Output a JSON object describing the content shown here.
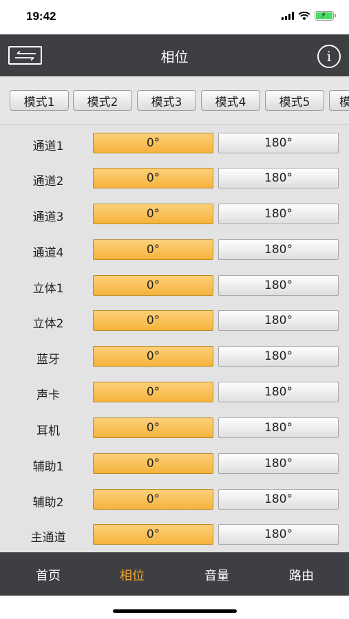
{
  "status_bar": {
    "time": "19:42"
  },
  "nav": {
    "title": "相位",
    "info_symbol": "i"
  },
  "modes": [
    "模式1",
    "模式2",
    "模式3",
    "模式4",
    "模式5",
    "模"
  ],
  "channels": [
    {
      "label": "通道1",
      "option_a": "0°",
      "option_b": "180°",
      "selected": "0°"
    },
    {
      "label": "通道2",
      "option_a": "0°",
      "option_b": "180°",
      "selected": "0°"
    },
    {
      "label": "通道3",
      "option_a": "0°",
      "option_b": "180°",
      "selected": "0°"
    },
    {
      "label": "通道4",
      "option_a": "0°",
      "option_b": "180°",
      "selected": "0°"
    },
    {
      "label": "立体1",
      "option_a": "0°",
      "option_b": "180°",
      "selected": "0°"
    },
    {
      "label": "立体2",
      "option_a": "0°",
      "option_b": "180°",
      "selected": "0°"
    },
    {
      "label": "蓝牙",
      "option_a": "0°",
      "option_b": "180°",
      "selected": "0°"
    },
    {
      "label": "声卡",
      "option_a": "0°",
      "option_b": "180°",
      "selected": "0°"
    },
    {
      "label": "耳机",
      "option_a": "0°",
      "option_b": "180°",
      "selected": "0°"
    },
    {
      "label": "辅助1",
      "option_a": "0°",
      "option_b": "180°",
      "selected": "0°"
    },
    {
      "label": "辅助2",
      "option_a": "0°",
      "option_b": "180°",
      "selected": "0°"
    },
    {
      "label": "主通道",
      "option_a": "0°",
      "option_b": "180°",
      "selected": "0°"
    }
  ],
  "tabs": [
    {
      "label": "首页",
      "active": false
    },
    {
      "label": "相位",
      "active": true
    },
    {
      "label": "音量",
      "active": false
    },
    {
      "label": "路由",
      "active": false
    }
  ],
  "colors": {
    "accent": "#f0a42a",
    "bar_bg": "#3d3f42",
    "selected_fill": "#f5b33c",
    "wifi_battery_charge": "#4cd964"
  },
  "icons": {
    "nav_left": "swap-arrows-icon",
    "nav_right": "info-icon"
  }
}
